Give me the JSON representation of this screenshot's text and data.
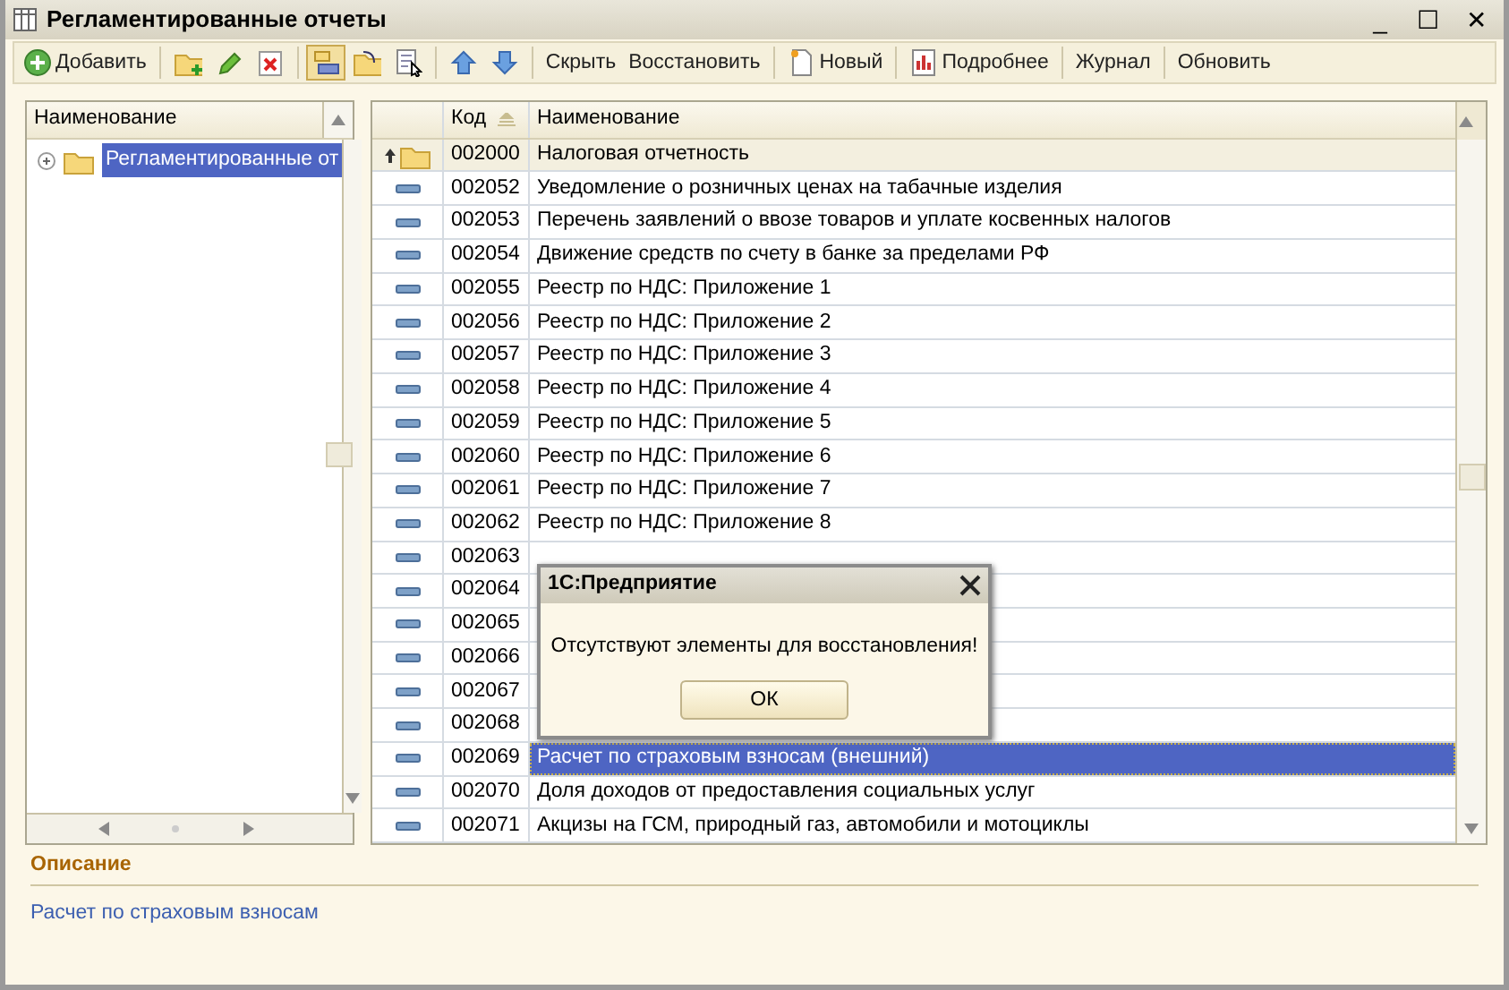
{
  "window": {
    "title": "Регламентированные отчеты",
    "controls": [
      "_",
      "☐",
      "✕"
    ]
  },
  "toolbar": [
    {
      "kind": "text",
      "label": "Добавить",
      "pressed": false,
      "separator_before": false
    },
    {
      "kind": "icon",
      "pressed": false,
      "separator_before": true
    },
    {
      "kind": "icon",
      "pressed": false,
      "separator_before": false
    },
    {
      "kind": "icon",
      "pressed": false,
      "separator_before": false
    },
    {
      "kind": "icon",
      "pressed": true,
      "separator_before": true
    },
    {
      "kind": "icon",
      "pressed": false,
      "separator_before": false
    },
    {
      "kind": "icon",
      "pressed": false,
      "separator_before": false
    },
    {
      "kind": "icon",
      "pressed": false,
      "separator_before": true
    },
    {
      "kind": "icon",
      "pressed": false,
      "separator_before": false
    },
    {
      "kind": "text",
      "label": "Скрыть",
      "pressed": false,
      "separator_before": true
    },
    {
      "kind": "text",
      "label": "Восстановить",
      "pressed": false,
      "separator_before": false
    },
    {
      "kind": "text",
      "label": "Новый",
      "pressed": false,
      "separator_before": true
    },
    {
      "kind": "text",
      "label": "Подробнее",
      "pressed": false,
      "separator_before": true
    },
    {
      "kind": "text",
      "label": "Журнал",
      "pressed": false,
      "separator_before": true
    },
    {
      "kind": "text",
      "label": "Обновить",
      "pressed": false,
      "separator_before": true
    }
  ],
  "tree": {
    "column": "Наименование",
    "items": [
      {
        "label": "Регламентированные от",
        "expanded": false,
        "selected": true
      }
    ]
  },
  "table": {
    "columns": [
      "Код",
      "Наименование"
    ],
    "rows": [
      {
        "kind": "parent",
        "code": "002000",
        "name": "Налоговая отчетность",
        "selected": false
      },
      {
        "kind": "item",
        "code": "002052",
        "name": "Уведомление о розничных ценах на табачные изделия",
        "selected": false
      },
      {
        "kind": "item",
        "code": "002053",
        "name": "Перечень заявлений о ввозе товаров и уплате косвенных налогов",
        "selected": false
      },
      {
        "kind": "item",
        "code": "002054",
        "name": "Движение средств по счету в банке за пределами РФ",
        "selected": false
      },
      {
        "kind": "item",
        "code": "002055",
        "name": "Реестр по НДС: Приложение 1",
        "selected": false
      },
      {
        "kind": "item",
        "code": "002056",
        "name": "Реестр по НДС: Приложение 2",
        "selected": false
      },
      {
        "kind": "item",
        "code": "002057",
        "name": "Реестр по НДС: Приложение 3",
        "selected": false
      },
      {
        "kind": "item",
        "code": "002058",
        "name": "Реестр по НДС: Приложение 4",
        "selected": false
      },
      {
        "kind": "item",
        "code": "002059",
        "name": "Реестр по НДС: Приложение 5",
        "selected": false
      },
      {
        "kind": "item",
        "code": "002060",
        "name": "Реестр по НДС: Приложение 6",
        "selected": false
      },
      {
        "kind": "item",
        "code": "002061",
        "name": "Реестр по НДС: Приложение 7",
        "selected": false
      },
      {
        "kind": "item",
        "code": "002062",
        "name": "Реестр по НДС: Приложение 8",
        "selected": false
      },
      {
        "kind": "item",
        "code": "002063",
        "selected": false
      },
      {
        "kind": "item",
        "code": "002064",
        "selected": false
      },
      {
        "kind": "item",
        "code": "002065",
        "selected": false
      },
      {
        "kind": "item",
        "code": "002066",
        "selected": false
      },
      {
        "kind": "item",
        "code": "002067",
        "selected": false
      },
      {
        "kind": "item",
        "code": "002068",
        "selected": false
      },
      {
        "kind": "item",
        "code": "002069",
        "name": "Расчет по страховым взносам (внешний)",
        "selected": true
      },
      {
        "kind": "item",
        "code": "002070",
        "name": "Доля доходов от предоставления социальных услуг",
        "selected": false
      },
      {
        "kind": "item",
        "code": "002071",
        "name": "Акцизы на ГСМ, природный газ, автомобили и мотоциклы",
        "selected": false
      }
    ]
  },
  "description": {
    "heading": "Описание",
    "text": "Расчет по страховым взносам"
  },
  "dialog": {
    "title": "1С:Предприятие",
    "message": "Отсутствуют элементы для восстановления!",
    "button": "ОК"
  }
}
